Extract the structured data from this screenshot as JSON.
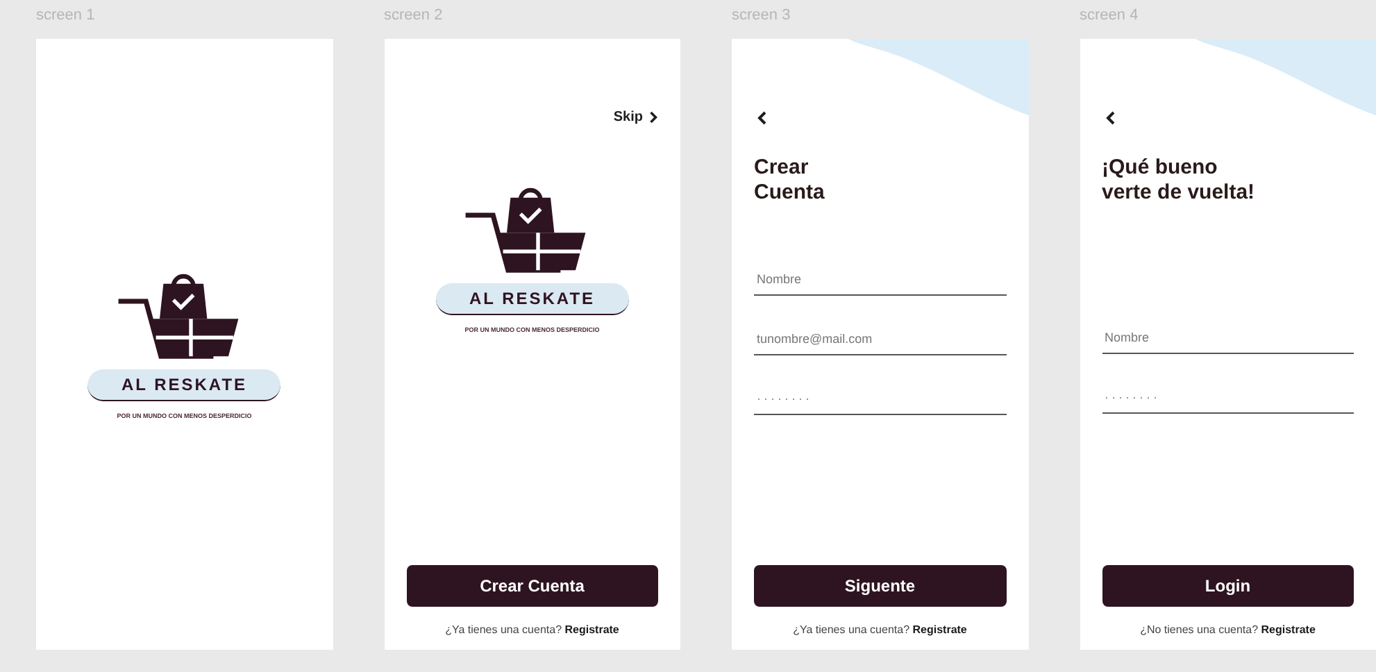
{
  "screens": [
    {
      "kind": "splash",
      "label": "screen 1",
      "logo": {
        "name": "AL RESKATE",
        "tagline": "POR UN MUNDO CON MENOS DESPERDICIO"
      }
    },
    {
      "kind": "onboarding",
      "label": "screen 2",
      "skip": "Skip",
      "logo": {
        "name": "AL RESKATE",
        "tagline": "POR UN MUNDO CON MENOS DESPERDICIO"
      },
      "button": "Crear Cuenta",
      "footer": {
        "text": "¿Ya tienes una cuenta?",
        "link": "Registrate"
      }
    },
    {
      "kind": "form",
      "label": "screen 3",
      "back": true,
      "title": [
        "Crear",
        "Cuenta"
      ],
      "fields": [
        {
          "kind": "text",
          "placeholder": "Nombre"
        },
        {
          "kind": "text",
          "placeholder": "tunombre@mail.com"
        },
        {
          "kind": "password",
          "value": "········"
        }
      ],
      "button": "Siguente",
      "footer": {
        "text": "¿Ya tienes una cuenta?",
        "link": "Registrate"
      }
    },
    {
      "kind": "form",
      "label": "screen 4",
      "back": true,
      "title": [
        "¡Qué bueno",
        "verte de vuelta!"
      ],
      "fields": [
        {
          "kind": "text",
          "placeholder": "Nombre"
        },
        {
          "kind": "password",
          "value": "········"
        }
      ],
      "button": "Login",
      "footer": {
        "text": "¿No tienes una cuenta?",
        "link": "Registrate"
      }
    }
  ]
}
